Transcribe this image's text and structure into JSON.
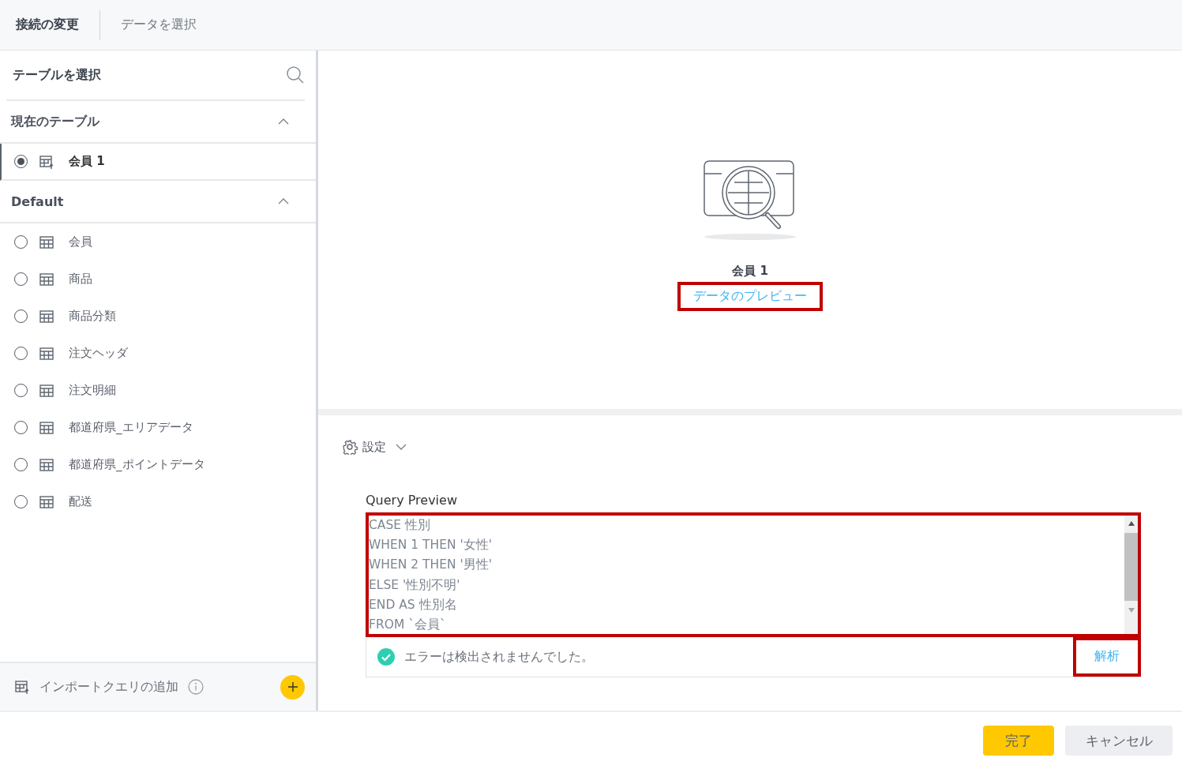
{
  "header": {
    "tabs": [
      {
        "label": "接続の変更",
        "selected": true
      },
      {
        "label": "データを選択",
        "selected": false
      }
    ]
  },
  "sidebar": {
    "title": "テーブルを選択",
    "sections": [
      {
        "title": "現在のテーブル",
        "expanded": true,
        "items": [
          {
            "label": "会員 1",
            "kind": "query",
            "selected": true
          }
        ]
      },
      {
        "title": "Default",
        "expanded": true,
        "items": [
          {
            "label": "会員",
            "kind": "table",
            "selected": false
          },
          {
            "label": "商品",
            "kind": "table",
            "selected": false
          },
          {
            "label": "商品分類",
            "kind": "table",
            "selected": false
          },
          {
            "label": "注文ヘッダ",
            "kind": "table",
            "selected": false
          },
          {
            "label": "注文明細",
            "kind": "table",
            "selected": false
          },
          {
            "label": "都道府県_エリアデータ",
            "kind": "table",
            "selected": false
          },
          {
            "label": "都道府県_ポイントデータ",
            "kind": "table",
            "selected": false
          },
          {
            "label": "配送",
            "kind": "table",
            "selected": false
          }
        ]
      }
    ],
    "footer": {
      "label": "インポートクエリの追加"
    }
  },
  "preview": {
    "table_name": "会員 1",
    "link": "データのプレビュー"
  },
  "settings": {
    "label": "設定",
    "expanded": false
  },
  "query": {
    "title": "Query Preview",
    "lines": [
      "CASE 性別",
      "WHEN 1 THEN '女性'",
      "WHEN 2 THEN '男性'",
      "ELSE '性別不明'",
      "END AS 性別名",
      "FROM `会員`"
    ],
    "status": "エラーは検出されませんでした。",
    "analyze": "解析"
  },
  "buttons": [
    {
      "label": "完了",
      "kind": "primary"
    },
    {
      "label": "キャンセル",
      "kind": "secondary"
    }
  ]
}
